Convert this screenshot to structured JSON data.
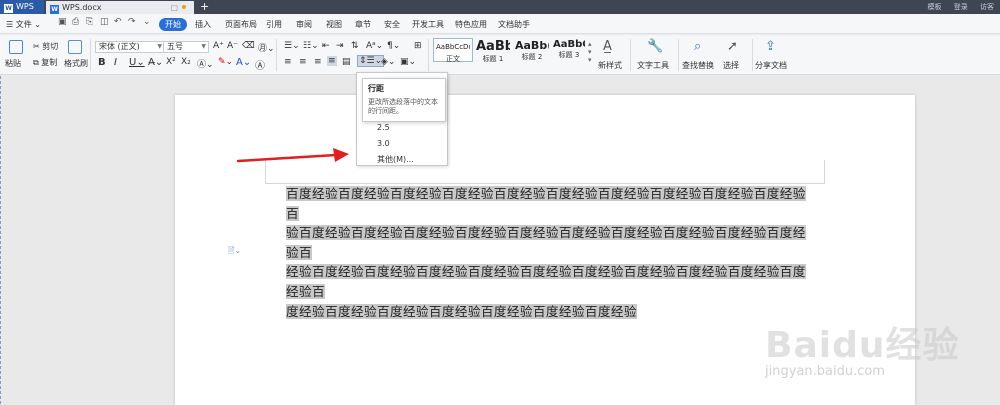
{
  "titlebar": {
    "app_tab": "WPS",
    "doc_tab": "WPS.docx",
    "right": [
      "模板",
      "登录",
      "访客"
    ]
  },
  "menubar": {
    "file_label": "文件",
    "tabs": [
      "开始",
      "插入",
      "页面布局",
      "引用",
      "审阅",
      "视图",
      "章节",
      "安全",
      "开发工具",
      "特色应用",
      "文档助手"
    ],
    "active_tab": "开始"
  },
  "ribbon": {
    "paste": "粘贴",
    "cut": "剪切",
    "copy": "复制",
    "format_painter": "格式刷",
    "font_name": "宋体 (正文)",
    "font_size": "五号",
    "styles": [
      {
        "sample": "AaBbCcDd",
        "label": "正文"
      },
      {
        "sample": "AaBb",
        "label": "标题 1"
      },
      {
        "sample": "AaBb(",
        "label": "标题 2"
      },
      {
        "sample": "AaBbC(",
        "label": "标题 3"
      }
    ],
    "new_style": "新样式",
    "text_tools": "文字工具",
    "find_replace": "查找替换",
    "select": "选择",
    "share_doc": "分享文档"
  },
  "line_spacing_menu": {
    "items": [
      "2.5",
      "3.0",
      "其他(M)..."
    ]
  },
  "tooltip": {
    "title": "行距",
    "description": "更改所选段落中的文本的行间距。"
  },
  "document": {
    "lines": [
      "百度经验百度经验百度经验百度经验百度经验百度经验百度经验百度经验百度经验百度经验百",
      "验百度经验百度经验百度经验百度经验百度经验百度经验百度经验百度经验百度经验百度经验百",
      "经验百度经验百度经验百度经验百度经验百度经验百度经验百度经验百度经验百度经验百度经验百",
      "度经验百度经验百度经验百度经验百度经验百度经验百度经验"
    ]
  },
  "watermark": {
    "brand": "Baidu经验",
    "url": "jingyan.baidu.com"
  }
}
